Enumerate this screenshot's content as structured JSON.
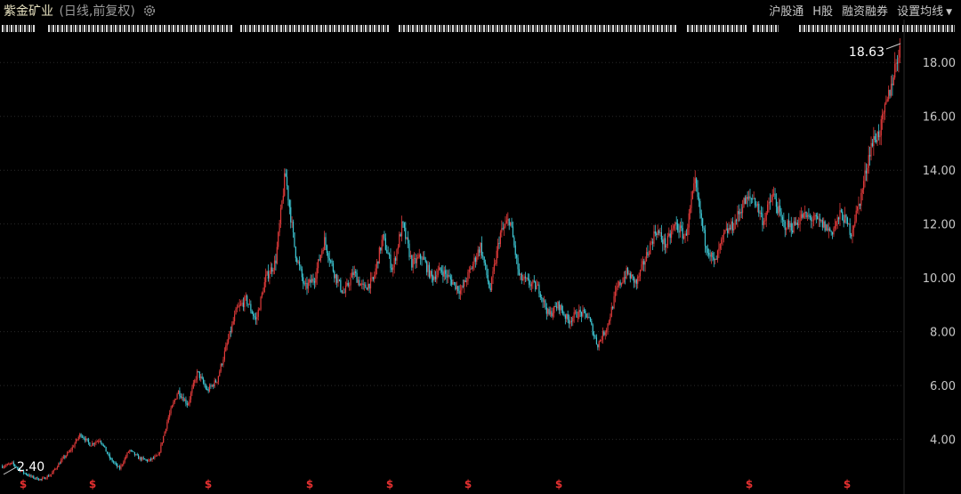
{
  "header": {
    "stock_name": "紫金矿业",
    "chart_mode": "(日线,前复权)",
    "menu": [
      "沪股通",
      "H股",
      "融资融券",
      "设置均线"
    ]
  },
  "colors": {
    "background": "#000000",
    "up": "#e03a3a",
    "down": "#3ec9d6",
    "grid": "#2a2a2a",
    "title": "#e8e2c0"
  },
  "chart_data": {
    "type": "candlestick",
    "title": "紫金矿业 (日线,前复权)",
    "y_ticks": [
      "4.00",
      "6.00",
      "8.00",
      "10.00",
      "12.00",
      "14.00",
      "16.00",
      "18.00"
    ],
    "ylim": [
      2.2,
      19.0
    ],
    "grid": true,
    "low_label": "2.40",
    "high_label": "18.63",
    "price_path": [
      3.0,
      3.1,
      2.8,
      2.6,
      2.5,
      2.7,
      3.2,
      3.6,
      4.2,
      3.8,
      4.0,
      3.3,
      2.9,
      3.6,
      3.3,
      3.2,
      3.4,
      4.8,
      5.8,
      5.3,
      6.5,
      5.8,
      6.2,
      7.5,
      8.8,
      9.2,
      8.4,
      10.0,
      10.6,
      13.9,
      11.0,
      9.6,
      10.0,
      11.4,
      10.2,
      9.4,
      10.2,
      9.6,
      9.9,
      11.5,
      10.3,
      12.0,
      10.5,
      10.8,
      10.0,
      10.3,
      9.9,
      9.5,
      10.3,
      11.2,
      9.5,
      11.6,
      12.2,
      10.0,
      9.8,
      9.6,
      8.6,
      9.0,
      8.4,
      8.7,
      8.6,
      7.5,
      8.2,
      9.6,
      10.2,
      9.8,
      10.8,
      11.8,
      11.2,
      12.0,
      11.5,
      13.5,
      11.4,
      10.5,
      11.6,
      12.0,
      12.8,
      13.0,
      12.1,
      13.1,
      12.0,
      11.9,
      12.3,
      12.2,
      12.0,
      11.7,
      12.4,
      11.7,
      13.0,
      14.9,
      15.5,
      17.0,
      18.63
    ],
    "div_markers": [
      "$",
      "$",
      "$",
      "$",
      "$",
      "$",
      "$",
      "$",
      "$"
    ]
  }
}
